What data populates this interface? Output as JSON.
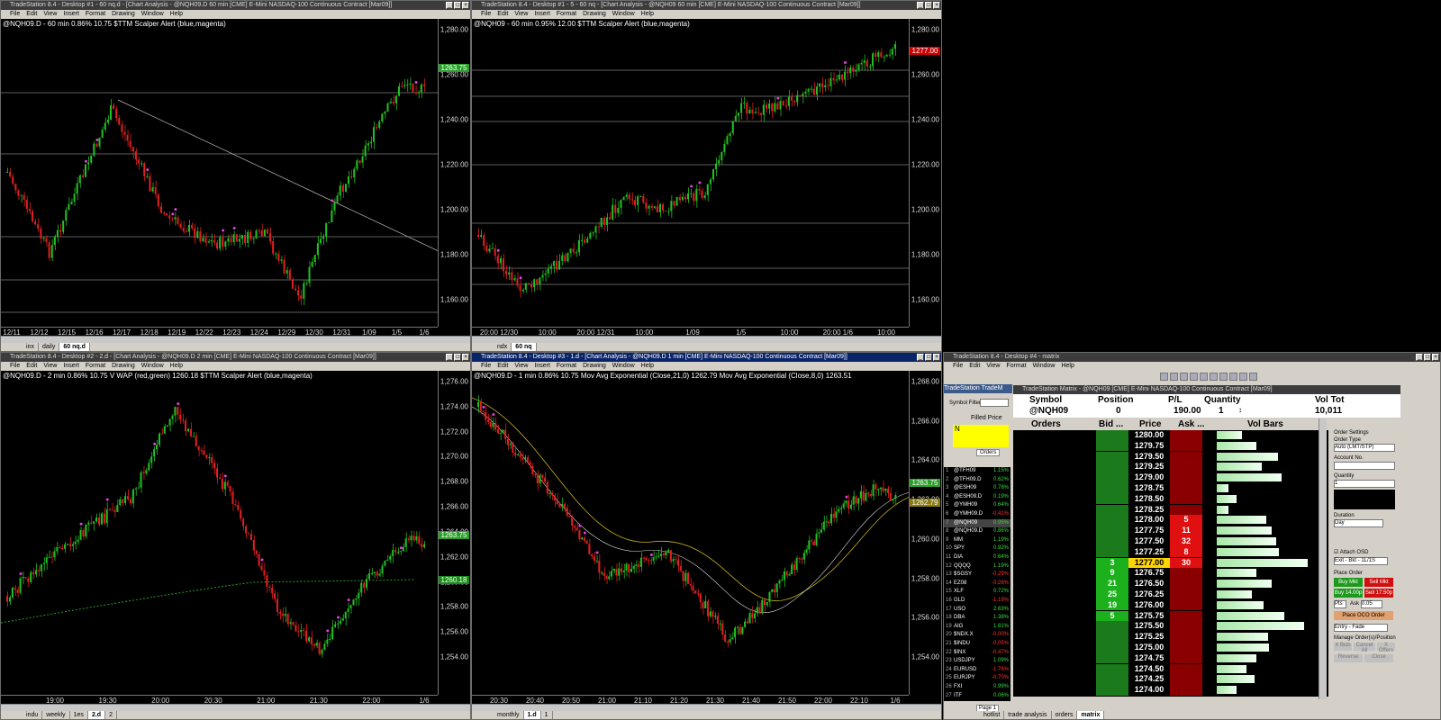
{
  "windows": [
    {
      "title": "TradeStation 8.4 - Desktop #1 - 60 nq.d - [Chart Analysis - @NQH09.D  60 min  [CME] E-Mini NASDAQ-100 Continuous Contract [Mar09]]",
      "legend": "@NQH09.D - 60 min  0.86%  10.75  $TTM Scalper Alert (blue,magenta)",
      "yticks": [
        "1,280.00",
        "1,260.00",
        "1,240.00",
        "1,220.00",
        "1,200.00",
        "1,180.00",
        "1,160.00"
      ],
      "xticks": [
        "12/11",
        "12/12",
        "12/15",
        "12/16",
        "12/17",
        "12/18",
        "12/19",
        "12/22",
        "12/23",
        "12/24",
        "12/29",
        "12/30",
        "12/31",
        "1/09",
        "1/5",
        "1/6"
      ],
      "price_label": "1263.75",
      "tabs": [
        "inx",
        "daily",
        "60 nq.d"
      ],
      "active_tab": "60 nq.d"
    },
    {
      "title": "TradeStation 8.4 - Desktop #1 - 5 - 60 nq - [Chart Analysis - @NQH09  60 min  [CME] E-Mini NASDAQ-100 Continuous Contract [Mar09]]",
      "legend": "@NQH09 - 60 min  0.95%  12.00  $TTM Scalper Alert (blue,magenta)",
      "yticks": [
        "1,280.00",
        "1,260.00",
        "1,240.00",
        "1,220.00",
        "1,200.00",
        "1,180.00",
        "1,160.00"
      ],
      "xticks": [
        "20:00 12/30",
        "10:00",
        "20:00 12/31",
        "10:00",
        "1/09",
        "1/5",
        "10:00",
        "20:00  1/6",
        "10:00"
      ],
      "price_label": "1277.00",
      "tabs": [
        "ndx",
        "60 nq"
      ],
      "active_tab": "60 nq"
    },
    {
      "title": "TradeStation 8.4 - Desktop #2 - 2.d - [Chart Analysis - @NQH09.D  2 min  [CME] E-Mini NASDAQ-100 Continuous Contract [Mar09]]",
      "legend": "@NQH09.D - 2 min  0.86%  10.75  V WAP (red,green)  1260.18  $TTM Scalper Alert (blue,magenta)",
      "yticks": [
        "1,276.00",
        "1,274.00",
        "1,272.00",
        "1,270.00",
        "1,268.00",
        "1,266.00",
        "1,264.00",
        "1,262.00",
        "1,260.00",
        "1,258.00",
        "1,256.00",
        "1,254.00"
      ],
      "xticks": [
        "19:00",
        "19:30",
        "20:00",
        "20:30",
        "21:00",
        "21:30",
        "22:00",
        "1/6"
      ],
      "price_label": "1263.75",
      "price_label2": "1260.18",
      "tabs": [
        "indu",
        "weekly",
        "1es",
        "2.d",
        "2"
      ],
      "active_tab": "2.d"
    },
    {
      "title": "TradeStation 8.4 - Desktop #3 - 1.d - [Chart Analysis - @NQH09.D  1 min  [CME] E-Mini NASDAQ-100 Continuous Contract [Mar09]]",
      "legend": "@NQH09.D - 1 min  0.86%  10.75  Mov Avg Exponential (Close,21,0)  1262.79  Mov Avg Exponential (Close,8,0)  1263.51",
      "yticks": [
        "1,268.00",
        "1,266.00",
        "1,264.00",
        "1,262.00",
        "1,260.00",
        "1,258.00",
        "1,256.00",
        "1,254.00"
      ],
      "xticks": [
        "20:30",
        "20:40",
        "20:50",
        "21:00",
        "21:10",
        "21:20",
        "21:30",
        "21:40",
        "21:50",
        "22:00",
        "22:10",
        "1/6"
      ],
      "price_label": "1263.75",
      "price_label2": "1262.79",
      "tabs": [
        "monthly",
        "1.d",
        "1"
      ],
      "active_tab": "1.d"
    }
  ],
  "matrix": {
    "title": "TradeStation 8.4 - Desktop #4 - matrix",
    "inner_title": "TradeStation Matrix - @NQH09 [CME] E-Mini NASDAQ-100 Continuous Contract [Mar09]",
    "menu": [
      "File",
      "Edit",
      "View",
      "Format",
      "Window",
      "Help"
    ],
    "side_title": "TradeStation TradeM",
    "symbol_filter_label": "Symbol Filter",
    "filled_price_label": "Filled Price",
    "orders_tab": "Orders",
    "header": {
      "symbol": "Symbol",
      "position": "Position",
      "pl": "P/L",
      "quantity": "Quantity",
      "vol_tot": "Vol Tot"
    },
    "header_values": {
      "symbol": "@NQH09",
      "position": "0",
      "pl": "190.00",
      "quantity": "1",
      "vol_tot": "10,011"
    },
    "columns": [
      "Orders",
      "Bid ...",
      "Price",
      "Ask ...",
      "Vol Bars"
    ],
    "ladder": [
      {
        "price": "1280.00",
        "bid": "",
        "ask": "",
        "vol": 0.25
      },
      {
        "price": "1279.75",
        "bid": "",
        "ask": "",
        "vol": 0.4
      },
      {
        "price": "1279.50",
        "bid": "",
        "ask": "",
        "vol": 0.62
      },
      {
        "price": "1279.25",
        "bid": "",
        "ask": "",
        "vol": 0.45
      },
      {
        "price": "1279.00",
        "bid": "",
        "ask": "",
        "vol": 0.65
      },
      {
        "price": "1278.75",
        "bid": "",
        "ask": "",
        "vol": 0.12
      },
      {
        "price": "1278.50",
        "bid": "",
        "ask": "",
        "vol": 0.2
      },
      {
        "price": "1278.25",
        "bid": "",
        "ask": "",
        "vol": 0.12
      },
      {
        "price": "1278.00",
        "bid": "",
        "ask": "5",
        "vol": 0.5
      },
      {
        "price": "1277.75",
        "bid": "",
        "ask": "11",
        "vol": 0.55
      },
      {
        "price": "1277.50",
        "bid": "",
        "ask": "32",
        "vol": 0.6
      },
      {
        "price": "1277.25",
        "bid": "",
        "ask": "8",
        "vol": 0.63
      },
      {
        "price": "1277.00",
        "bid": "3",
        "ask": "30",
        "vol": 0.92,
        "current": true
      },
      {
        "price": "1276.75",
        "bid": "9",
        "ask": "",
        "vol": 0.4
      },
      {
        "price": "1276.50",
        "bid": "21",
        "ask": "",
        "vol": 0.55
      },
      {
        "price": "1276.25",
        "bid": "25",
        "ask": "",
        "vol": 0.35
      },
      {
        "price": "1276.00",
        "bid": "19",
        "ask": "",
        "vol": 0.47
      },
      {
        "price": "1275.75",
        "bid": "5",
        "ask": "",
        "vol": 0.68
      },
      {
        "price": "1275.50",
        "bid": "",
        "ask": "",
        "vol": 0.88
      },
      {
        "price": "1275.25",
        "bid": "",
        "ask": "",
        "vol": 0.52
      },
      {
        "price": "1275.00",
        "bid": "",
        "ask": "",
        "vol": 0.53
      },
      {
        "price": "1274.75",
        "bid": "",
        "ask": "",
        "vol": 0.4
      },
      {
        "price": "1274.50",
        "bid": "",
        "ask": "",
        "vol": 0.3
      },
      {
        "price": "1274.25",
        "bid": "",
        "ask": "",
        "vol": 0.38
      },
      {
        "price": "1274.00",
        "bid": "",
        "ask": "",
        "vol": 0.2
      }
    ],
    "watchlist": [
      {
        "sym": "@TFH09",
        "chg": "1.15%",
        "up": true
      },
      {
        "sym": "@TFH09.D",
        "chg": "0.62%",
        "up": true
      },
      {
        "sym": "@ESH09",
        "chg": "0.78%",
        "up": true
      },
      {
        "sym": "@ESH09.D",
        "chg": "0.19%",
        "up": true
      },
      {
        "sym": "@YMH09",
        "chg": "0.64%",
        "up": true
      },
      {
        "sym": "@YMH09.D",
        "chg": "-0.41%",
        "up": false
      },
      {
        "sym": "@NQH09",
        "chg": "0.95%",
        "up": true
      },
      {
        "sym": "@NQH09.D",
        "chg": "0.86%",
        "up": true
      },
      {
        "sym": "MM",
        "chg": "1.19%",
        "up": true
      },
      {
        "sym": "SPY",
        "chg": "0.92%",
        "up": true
      },
      {
        "sym": "DIA",
        "chg": "0.64%",
        "up": true
      },
      {
        "sym": "QQQQ",
        "chg": "1.19%",
        "up": true
      },
      {
        "sym": "$SGSY",
        "chg": "-0.29%",
        "up": false
      },
      {
        "sym": "EZ08",
        "chg": "-0.26%",
        "up": false
      },
      {
        "sym": "XLF",
        "chg": "0.72%",
        "up": true
      },
      {
        "sym": "GLD",
        "chg": "-1.19%",
        "up": false
      },
      {
        "sym": "USO",
        "chg": "2.63%",
        "up": true
      },
      {
        "sym": "DBA",
        "chg": "1.38%",
        "up": true
      },
      {
        "sym": "AIG",
        "chg": "1.81%",
        "up": true
      },
      {
        "sym": "$NDX.X",
        "chg": "-0.00%",
        "up": false
      },
      {
        "sym": "$INDU",
        "chg": "-0.05%",
        "up": false
      },
      {
        "sym": "$INX",
        "chg": "-0.47%",
        "up": false
      },
      {
        "sym": "USDJPY",
        "chg": "1.09%",
        "up": true
      },
      {
        "sym": "EURUSD",
        "chg": "-1.76%",
        "up": false
      },
      {
        "sym": "EURJPY",
        "chg": "-0.70%",
        "up": false
      },
      {
        "sym": "FXI",
        "chg": "0.99%",
        "up": true
      },
      {
        "sym": "ITF",
        "chg": "0.06%",
        "up": true
      }
    ],
    "order_settings": {
      "title": "Order Settings",
      "order_type_label": "Order Type",
      "order_type": "Auto (LMT/STP)",
      "account_label": "Account No.",
      "quantity_label": "Quantity",
      "quantity": "1",
      "duration_label": "Duration",
      "duration": "Day",
      "attach_osd": "Attach OSD",
      "osd_value": "Exit - Bkt - 1L/1S",
      "place_order_label": "Place Order",
      "buy_mkt": "Buy Mkt",
      "sell_mkt": "Sell Mkt",
      "buy_bid": "Buy 14.00p",
      "sell_ask": "Sell 17.50p",
      "pts": "Pts",
      "ask": "Ask",
      "ask_val": "0.05",
      "place_oco": "Place OCO Order",
      "entry": "Entry - Fade",
      "manage_label": "Manage Order(s)/Position",
      "x_bids": "X Bids",
      "cancel_all": "Cancel All",
      "x_offers": "X Offers",
      "reverse": "Reverse",
      "close": "Close"
    },
    "page_tab": "Page 1",
    "bottom_tabs": [
      "hotlist",
      "trade analysis",
      "orders",
      "matrix"
    ],
    "active_bottom_tab": "matrix"
  }
}
